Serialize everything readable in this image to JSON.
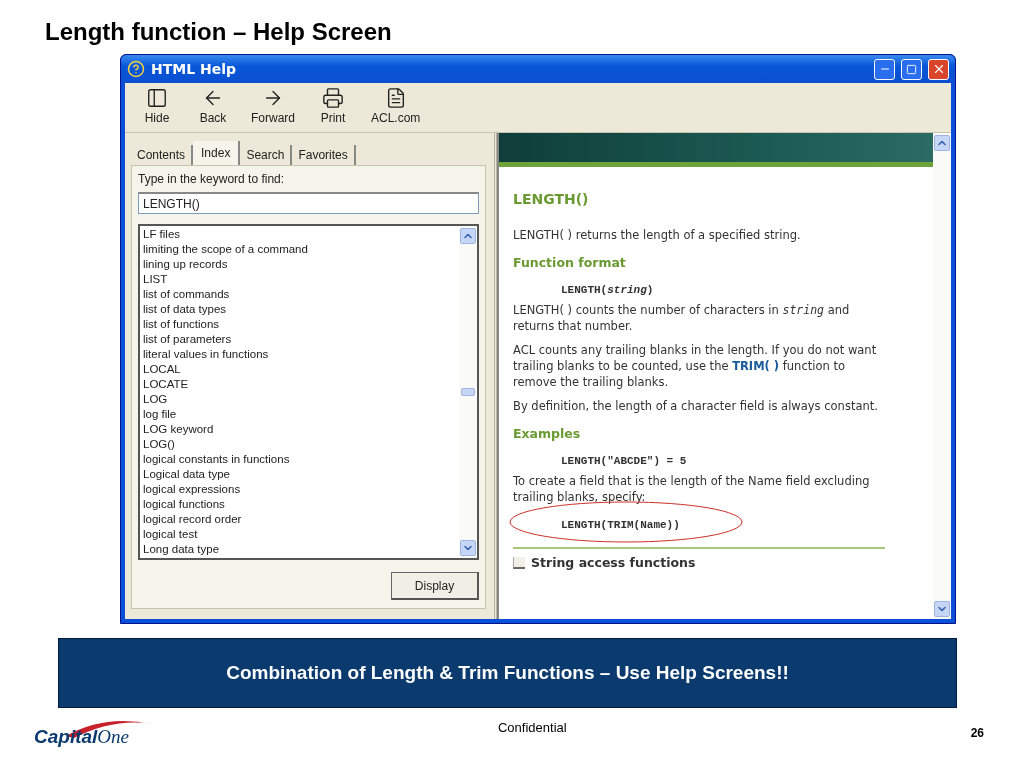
{
  "slide_title": "Length function – Help Screen",
  "window": {
    "title": "HTML Help",
    "toolbar": [
      "Hide",
      "Back",
      "Forward",
      "Print",
      "ACL.com"
    ],
    "tabs": [
      {
        "label": "Contents",
        "selected": false
      },
      {
        "label": "Index",
        "selected": true
      },
      {
        "label": "Search",
        "selected": false
      },
      {
        "label": "Favorites",
        "selected": false
      }
    ],
    "keyword_label": "Type in the keyword to find:",
    "keyword_value": "LENGTH()",
    "index_items": [
      "LF files",
      "limiting the scope of a command",
      "lining up records",
      "LIST",
      "list of commands",
      "list of data types",
      "list of functions",
      "list of parameters",
      "literal values in functions",
      "LOCAL",
      "LOCATE",
      "LOG",
      "log file",
      "LOG keyword",
      "LOG()",
      "logical constants in functions",
      "Logical data type",
      "logical expressions",
      "logical functions",
      "logical record order",
      "logical test",
      "Long data type"
    ],
    "display_button": "Display",
    "content": [
      {
        "kind": "heading",
        "text": "LENGTH()"
      },
      {
        "kind": "para",
        "text": "LENGTH( ) returns the length of a specified string."
      },
      {
        "kind": "subheading",
        "text": "Function format"
      },
      {
        "kind": "code",
        "text": "LENGTH(*string*)",
        "circled": false
      },
      {
        "kind": "para",
        "text": "LENGTH( ) counts the number of characters in *string* and returns that number."
      },
      {
        "kind": "para",
        "text": "ACL counts any trailing blanks in the length. If you do not want trailing blanks to be counted, use the **TRIM( )** function to remove the trailing blanks."
      },
      {
        "kind": "para",
        "text": "By definition, the length of a character field is always constant."
      },
      {
        "kind": "subheading",
        "text": "Examples"
      },
      {
        "kind": "code",
        "text": "LENGTH(\"ABCDE\") = 5",
        "circled": false
      },
      {
        "kind": "para",
        "text": "To create a field that is the length of the Name field excluding trailing blanks, specify:"
      },
      {
        "kind": "code",
        "text": "LENGTH(TRIM(Name))",
        "circled": true
      }
    ],
    "related_link": "String access functions"
  },
  "banner": "Combination of Length & Trim Functions – Use Help Screens!!",
  "footer": {
    "logo": [
      "Capital",
      "One"
    ],
    "confidential": "Confidential",
    "page_number": "26"
  }
}
